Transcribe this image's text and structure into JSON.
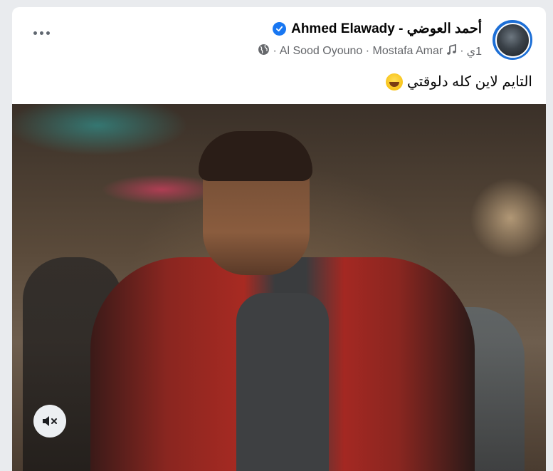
{
  "post": {
    "author_name": "Ahmed Elawady - أحمد العوضي",
    "meta": {
      "time": "1ي",
      "music": "Al Sood Oyouno · Mostafa Amar",
      "separator": "·"
    },
    "caption": "التايم لاين كله دلوقتي",
    "icons": {
      "verified": "verified-badge-icon",
      "music": "music-note-icon",
      "privacy": "globe-icon",
      "more": "more-options-icon",
      "mute": "speaker-muted-icon",
      "emoji": "laughing-emoji-icon"
    },
    "colors": {
      "verified": "#1877f2",
      "text_primary": "#050505",
      "text_secondary": "#65676b"
    }
  }
}
